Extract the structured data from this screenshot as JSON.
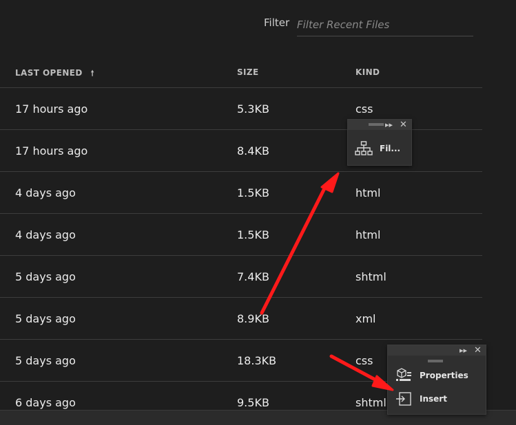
{
  "filter": {
    "label": "Filter",
    "placeholder": "Filter Recent Files"
  },
  "table": {
    "columns": [
      {
        "label": "LAST OPENED",
        "sorted": "ascending"
      },
      {
        "label": "SIZE"
      },
      {
        "label": "KIND"
      }
    ],
    "sort_icon": "arrow-up-icon",
    "rows": [
      {
        "opened": "17 hours ago",
        "size": "5.3KB",
        "kind": "css"
      },
      {
        "opened": "17 hours ago",
        "size": "8.4KB",
        "kind": ""
      },
      {
        "opened": "4 days ago",
        "size": "1.5KB",
        "kind": "html"
      },
      {
        "opened": "4 days ago",
        "size": "1.5KB",
        "kind": "html"
      },
      {
        "opened": "5 days ago",
        "size": "7.4KB",
        "kind": "shtml"
      },
      {
        "opened": "5 days ago",
        "size": "8.9KB",
        "kind": "xml"
      },
      {
        "opened": "5 days ago",
        "size": "18.3KB",
        "kind": "css"
      },
      {
        "opened": "6 days ago",
        "size": "9.5KB",
        "kind": "shtml"
      }
    ]
  },
  "files_panel": {
    "expand_icon": "double-chevron-right-icon",
    "close_icon": "close-icon",
    "items": [
      {
        "label": "Fil...",
        "icon": "sitemap-icon"
      }
    ]
  },
  "props_panel": {
    "expand_icon": "double-chevron-right-icon",
    "close_icon": "close-icon",
    "items": [
      {
        "label": "Properties",
        "icon": "properties-icon"
      },
      {
        "label": "Insert",
        "icon": "insert-icon"
      }
    ]
  },
  "colors": {
    "background": "#1e1e1e",
    "panel": "#2f2f2f",
    "divider": "#3d3d3d",
    "annotation_arrow": "#ff1a1a"
  }
}
